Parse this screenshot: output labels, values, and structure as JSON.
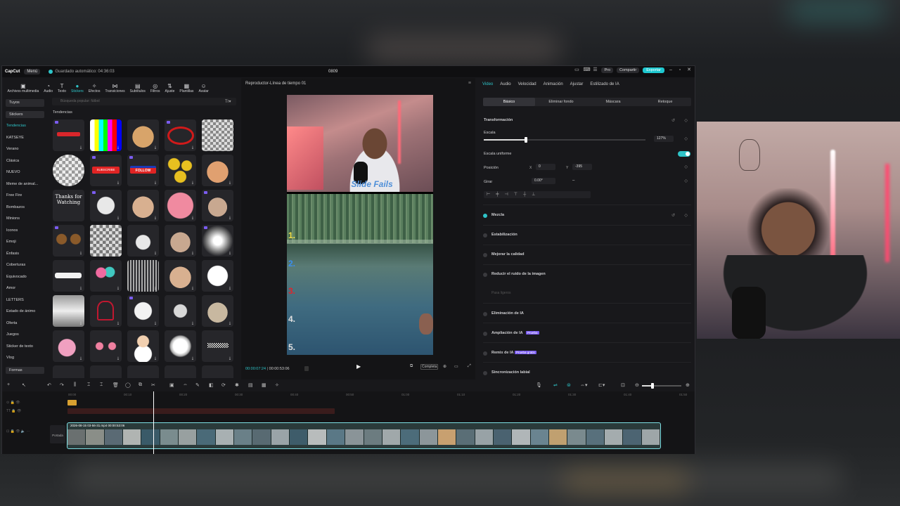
{
  "window": {
    "app_name": "CapCut",
    "menu": "Menú",
    "autosave": "Guardado automático: 04:36:03",
    "project": "0809",
    "pro": "Pro",
    "share": "Compartir",
    "export": "Exportar"
  },
  "tool_tabs": [
    "Archivos multimedia",
    "Audio",
    "Texto",
    "Stickers",
    "Efectos",
    "Transiciones",
    "Subtítulos",
    "Filtros",
    "Ajuste",
    "Plantillas",
    "Avatar"
  ],
  "categories": {
    "selector": "Tuyos",
    "stickers": "Stickers",
    "items": [
      "Tendencias",
      "KATSEYE",
      "Verano",
      "Clásica",
      "NUEVO",
      "Meme de animal...",
      "Free Fire",
      "Bombazos",
      "Minions",
      "Iconos",
      "Emoji",
      "Énfasis",
      "Coberturas",
      "Equivocado",
      "Amor",
      "LETTERS",
      "Estado de ánimo",
      "Oferta",
      "Juegos",
      "Sticker de texto",
      "Vlog",
      "Formas"
    ]
  },
  "stickers": {
    "search_placeholder": "Búsqueda popular: fútbol",
    "trending_label": "Tendencias",
    "sticker_texts": {
      "subscribe": "SUBSCRIBE",
      "follow": "FOLLOW",
      "thanks": "Thanks for Watching"
    }
  },
  "player": {
    "title": "Reproductor-Línea de tiempo 01",
    "current_time": "00:00:07:24",
    "total_time": "00:00:53:06",
    "ratio_btn": "Completa",
    "overlay_text": "Slide Fails",
    "numbers": [
      "1.",
      "2.",
      "3.",
      "4.",
      "5."
    ]
  },
  "inspector": {
    "tabs": [
      "Video",
      "Audio",
      "Velocidad",
      "Animación",
      "Ajustar",
      "Estilizado de IA"
    ],
    "subtabs": [
      "Básico",
      "Eliminar fondo",
      "Máscara",
      "Retoque"
    ],
    "transform_label": "Transformación",
    "scale_label": "Escala",
    "scale_value": "127%",
    "scale_value_num": 0.26,
    "uniform_label": "Escala uniforme",
    "position_label": "Posición",
    "pos_x_label": "X",
    "pos_x": "0",
    "pos_y_label": "Y",
    "pos_y": "-395",
    "rotate_label": "Girar",
    "rotate_value": "0.00°",
    "rotate_dash": "–",
    "blend_label": "Mezcla",
    "options": [
      "Estabilización",
      "Mejorar la calidad",
      "Reducir el ruido de la imagen",
      "Eliminación de IA",
      "Ampliación de IA",
      "Remix de IA",
      "Sincronización labial"
    ],
    "badge_ampliacion": "Prueba",
    "badge_remix": "Prueba gratis",
    "reduce_sub": "Pasa ligeros"
  },
  "timeline": {
    "ruler": [
      "00:00",
      "00:10",
      "00:20",
      "00:30",
      "00:40",
      "00:50",
      "01:00",
      "01:10",
      "01:20",
      "01:30",
      "01:40",
      "01:50"
    ],
    "clip_name": "2026-08-15 03-56-31.mp4  00:00:53:06",
    "cover": "Portada"
  },
  "colors": {
    "accent": "#2ec4c8",
    "badge": "#7b5cf0",
    "clip_border": "#7fe0e4"
  }
}
